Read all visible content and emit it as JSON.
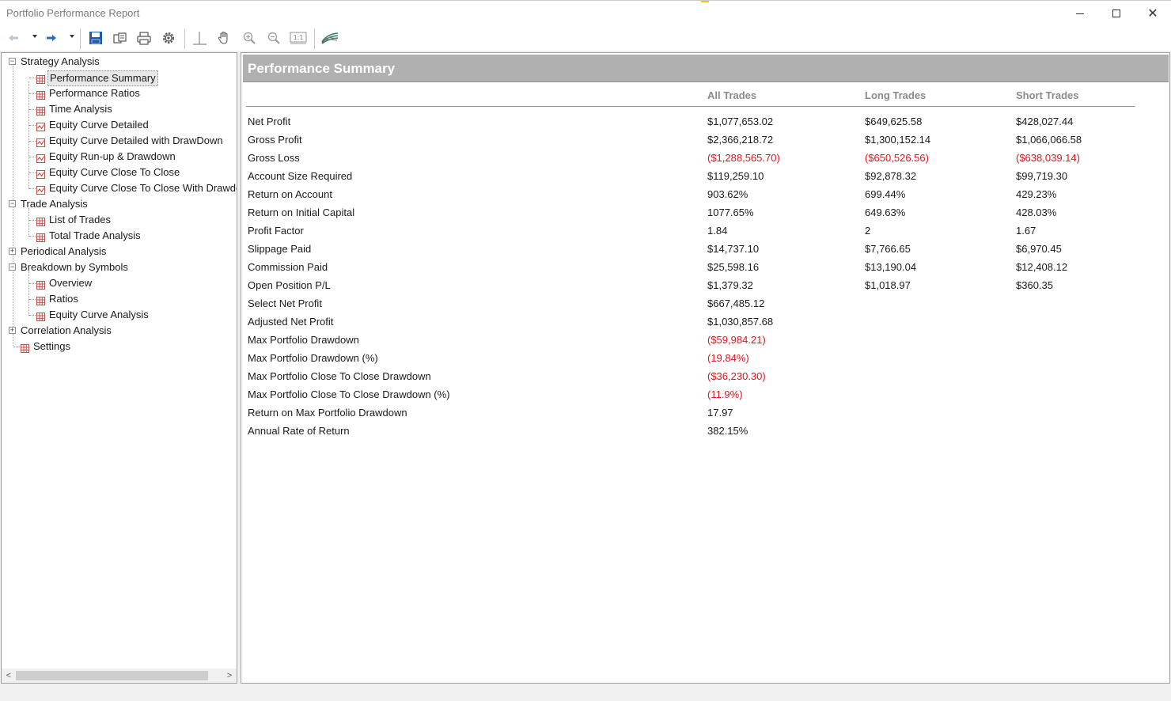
{
  "window": {
    "title": "Portfolio Performance Report",
    "minimize_label": "",
    "maximize_label": "",
    "close_label": "✕"
  },
  "toolbar": {
    "buttons": [
      "back-icon",
      "back-dropdown",
      "forward-icon",
      "forward-dropdown",
      "save-icon",
      "open-icon",
      "print-icon",
      "settings-icon",
      "crosshair-icon",
      "hand-pan-icon",
      "zoom-in-icon",
      "zoom-out-icon",
      "actual-size-icon",
      "chart-style-icon"
    ],
    "actual_size_text": "1:1"
  },
  "tree": {
    "items": [
      {
        "label": "Strategy Analysis",
        "level": 0,
        "type": "group",
        "expander": "−"
      },
      {
        "label": "Performance Summary",
        "level": 1,
        "type": "table",
        "selected": true
      },
      {
        "label": "Performance Ratios",
        "level": 1,
        "type": "table"
      },
      {
        "label": "Time Analysis",
        "level": 1,
        "type": "table"
      },
      {
        "label": "Equity Curve Detailed",
        "level": 1,
        "type": "chart"
      },
      {
        "label": "Equity Curve Detailed with DrawDown",
        "level": 1,
        "type": "chart"
      },
      {
        "label": "Equity Run-up & Drawdown",
        "level": 1,
        "type": "chart"
      },
      {
        "label": "Equity Curve Close To Close",
        "level": 1,
        "type": "chart"
      },
      {
        "label": "Equity Curve Close To Close With Drawdown",
        "level": 1,
        "type": "chart"
      },
      {
        "label": "Trade Analysis",
        "level": 0,
        "type": "group",
        "expander": "−"
      },
      {
        "label": "List of Trades",
        "level": 1,
        "type": "table"
      },
      {
        "label": "Total Trade Analysis",
        "level": 1,
        "type": "table"
      },
      {
        "label": "Periodical Analysis",
        "level": 0,
        "type": "group",
        "expander": "+"
      },
      {
        "label": "Breakdown by Symbols",
        "level": 0,
        "type": "group",
        "expander": "−"
      },
      {
        "label": "Overview",
        "level": 1,
        "type": "table"
      },
      {
        "label": "Ratios",
        "level": 1,
        "type": "table"
      },
      {
        "label": "Equity Curve Analysis",
        "level": 1,
        "type": "table"
      },
      {
        "label": "Correlation Analysis",
        "level": 0,
        "type": "group",
        "expander": "+"
      },
      {
        "label": "Settings",
        "level": 0,
        "type": "table-leaf"
      }
    ],
    "scroll_left": "<",
    "scroll_right": ">"
  },
  "content": {
    "section_title": "Performance Summary",
    "columns": [
      "All Trades",
      "Long Trades",
      "Short Trades"
    ],
    "rows": [
      {
        "label": "Net Profit",
        "values": [
          "$1,077,653.02",
          "$649,625.58",
          "$428,027.44"
        ],
        "negative": [
          false,
          false,
          false
        ]
      },
      {
        "label": "Gross Profit",
        "values": [
          "$2,366,218.72",
          "$1,300,152.14",
          "$1,066,066.58"
        ],
        "negative": [
          false,
          false,
          false
        ]
      },
      {
        "label": "Gross Loss",
        "values": [
          "($1,288,565.70)",
          "($650,526.56)",
          "($638,039.14)"
        ],
        "negative": [
          true,
          true,
          true
        ]
      },
      {
        "label": "Account Size Required",
        "values": [
          "$119,259.10",
          "$92,878.32",
          "$99,719.30"
        ],
        "negative": [
          false,
          false,
          false
        ]
      },
      {
        "label": "Return on Account",
        "values": [
          "903.62%",
          "699.44%",
          "429.23%"
        ],
        "negative": [
          false,
          false,
          false
        ]
      },
      {
        "label": "Return on Initial Capital",
        "values": [
          "1077.65%",
          "649.63%",
          "428.03%"
        ],
        "negative": [
          false,
          false,
          false
        ]
      },
      {
        "label": "Profit Factor",
        "values": [
          "1.84",
          "2",
          "1.67"
        ],
        "negative": [
          false,
          false,
          false
        ]
      },
      {
        "label": "Slippage Paid",
        "values": [
          "$14,737.10",
          "$7,766.65",
          "$6,970.45"
        ],
        "negative": [
          false,
          false,
          false
        ]
      },
      {
        "label": "Commission Paid",
        "values": [
          "$25,598.16",
          "$13,190.04",
          "$12,408.12"
        ],
        "negative": [
          false,
          false,
          false
        ]
      },
      {
        "label": "Open Position P/L",
        "values": [
          "$1,379.32",
          "$1,018.97",
          "$360.35"
        ],
        "negative": [
          false,
          false,
          false
        ]
      },
      {
        "label": "Select Net Profit",
        "values": [
          "$667,485.12",
          "",
          ""
        ],
        "negative": [
          false,
          false,
          false
        ]
      },
      {
        "label": "Adjusted Net Profit",
        "values": [
          "$1,030,857.68",
          "",
          ""
        ],
        "negative": [
          false,
          false,
          false
        ]
      },
      {
        "label": "Max Portfolio Drawdown",
        "values": [
          "($59,984.21)",
          "",
          ""
        ],
        "negative": [
          true,
          false,
          false
        ]
      },
      {
        "label": "Max Portfolio Drawdown (%)",
        "values": [
          "(19.84%)",
          "",
          ""
        ],
        "negative": [
          true,
          false,
          false
        ]
      },
      {
        "label": "Max Portfolio Close To Close Drawdown",
        "values": [
          "($36,230.30)",
          "",
          ""
        ],
        "negative": [
          true,
          false,
          false
        ]
      },
      {
        "label": "Max Portfolio Close To Close Drawdown (%)",
        "values": [
          "(11.9%)",
          "",
          ""
        ],
        "negative": [
          true,
          false,
          false
        ]
      },
      {
        "label": "Return on Max Portfolio Drawdown",
        "values": [
          "17.97",
          "",
          ""
        ],
        "negative": [
          false,
          false,
          false
        ]
      },
      {
        "label": "Annual Rate of Return",
        "values": [
          "382.15%",
          "",
          ""
        ],
        "negative": [
          false,
          false,
          false
        ]
      }
    ]
  },
  "colors": {
    "negative": "#e0141e",
    "header_bg": "#b0b0b0",
    "column_header": "#8a8a8a",
    "toolbar_blue": "#1e64b4",
    "table_icon": "#c0504d"
  }
}
